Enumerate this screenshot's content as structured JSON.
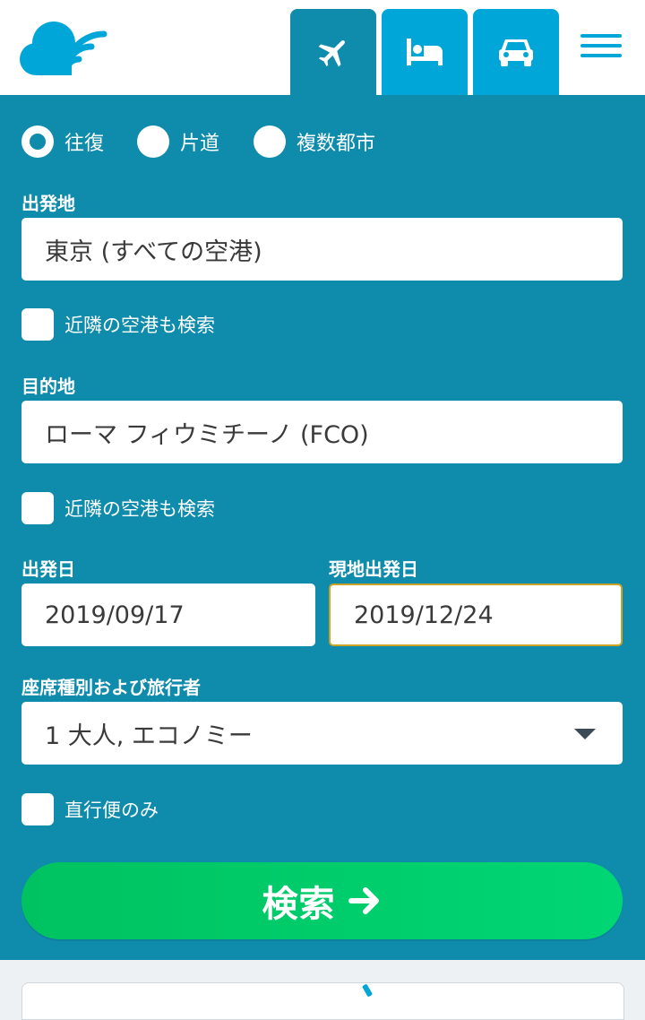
{
  "header": {
    "tabs": [
      {
        "name": "flights",
        "icon": "airplane-icon",
        "active": true
      },
      {
        "name": "hotels",
        "icon": "bed-icon",
        "active": false
      },
      {
        "name": "cars",
        "icon": "car-icon",
        "active": false
      }
    ],
    "menu_icon": "hamburger-menu-icon"
  },
  "trip_type": {
    "options": [
      "往復",
      "片道",
      "複数都市"
    ],
    "selected": "往復"
  },
  "origin": {
    "label": "出発地",
    "value": "東京 (すべての空港)",
    "nearby_label": "近隣の空港も検索"
  },
  "destination": {
    "label": "目的地",
    "value": "ローマ フィウミチーノ (FCO)",
    "nearby_label": "近隣の空港も検索"
  },
  "dates": {
    "depart_label": "出発日",
    "depart_value": "2019/09/17",
    "return_label": "現地出発日",
    "return_value": "2019/12/24"
  },
  "cabin": {
    "label": "座席種別および旅行者",
    "value": "1 大人, エコノミー"
  },
  "direct_only_label": "直行便のみ",
  "search_button_label": "検索",
  "colors": {
    "panel": "#0f8bab",
    "brand": "#00a6d8",
    "search_green": "#00c868",
    "active_field_border": "#c9a227"
  }
}
